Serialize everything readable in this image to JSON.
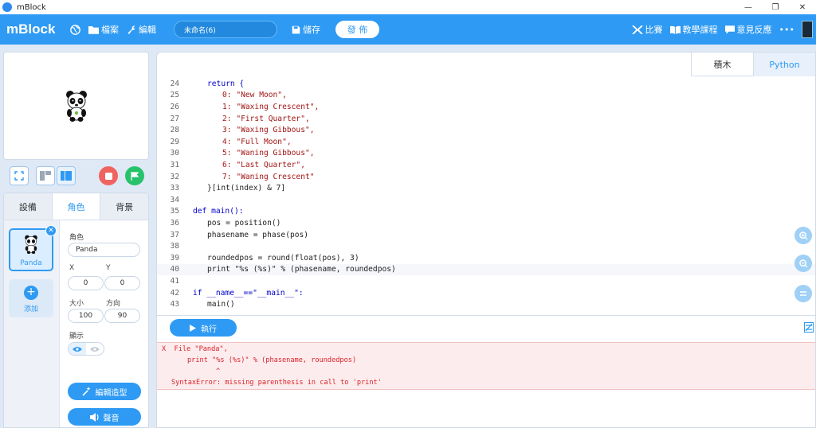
{
  "window": {
    "title": "mBlock"
  },
  "menubar": {
    "logo": "mBlock",
    "file_label": "檔案",
    "edit_label": "編輯",
    "project_name": "未命名(6)",
    "save_label": "儲存",
    "publish_label": "發 佈",
    "compete_label": "比賽",
    "tutorials_label": "教學課程",
    "feedback_label": "意見反應",
    "more_label": "•••"
  },
  "stage_controls": {
    "stop_color": "#f0645f",
    "go_color": "#27c26c"
  },
  "left_panel": {
    "tabs": [
      {
        "label": "設備"
      },
      {
        "label": "角色"
      },
      {
        "label": "背景"
      }
    ],
    "sprite": {
      "name": "Panda"
    },
    "add_label": "添加",
    "props": {
      "role_label": "角色",
      "name_value": "Panda",
      "x_label": "X",
      "y_label": "Y",
      "x_value": "0",
      "y_value": "0",
      "size_label": "大小",
      "direction_label": "方向",
      "size_value": "100",
      "direction_value": "90",
      "show_label": "顯示"
    },
    "edit_costume_label": "編輯造型",
    "sound_label": "聲音"
  },
  "editor": {
    "mode_tabs": [
      {
        "label": "積木"
      },
      {
        "label": "Python"
      }
    ],
    "lines": [
      {
        "n": "24",
        "text": "return {"
      },
      {
        "n": "25",
        "text": "0: \"New Moon\","
      },
      {
        "n": "26",
        "text": "1: \"Waxing Crescent\","
      },
      {
        "n": "27",
        "text": "2: \"First Quarter\","
      },
      {
        "n": "28",
        "text": "3: \"Waxing Gibbous\","
      },
      {
        "n": "29",
        "text": "4: \"Full Moon\","
      },
      {
        "n": "30",
        "text": "5: \"Waning Gibbous\","
      },
      {
        "n": "31",
        "text": "6: \"Last Quarter\","
      },
      {
        "n": "32",
        "text": "7: \"Waning Crescent\""
      },
      {
        "n": "33",
        "text": "}[int(index) & 7]"
      },
      {
        "n": "34",
        "text": ""
      },
      {
        "n": "35",
        "text": "def main():"
      },
      {
        "n": "36",
        "text": "pos = position()"
      },
      {
        "n": "37",
        "text": "phasename = phase(pos)"
      },
      {
        "n": "38",
        "text": ""
      },
      {
        "n": "39",
        "text": "roundedpos = round(float(pos), 3)"
      },
      {
        "n": "40",
        "text": "print \"%s (%s)\" % (phasename, roundedpos)"
      },
      {
        "n": "41",
        "text": ""
      },
      {
        "n": "42",
        "text": "if __name__==\"__main__\":"
      },
      {
        "n": "43",
        "text": "main()"
      }
    ],
    "run_label": "執行",
    "errors": [
      "X  File \"Panda\",",
      "print \"%s (%s)\" % (phasename, roundedpos)",
      "^",
      "SyntaxError: missing parenthesis in call to 'print'"
    ]
  }
}
